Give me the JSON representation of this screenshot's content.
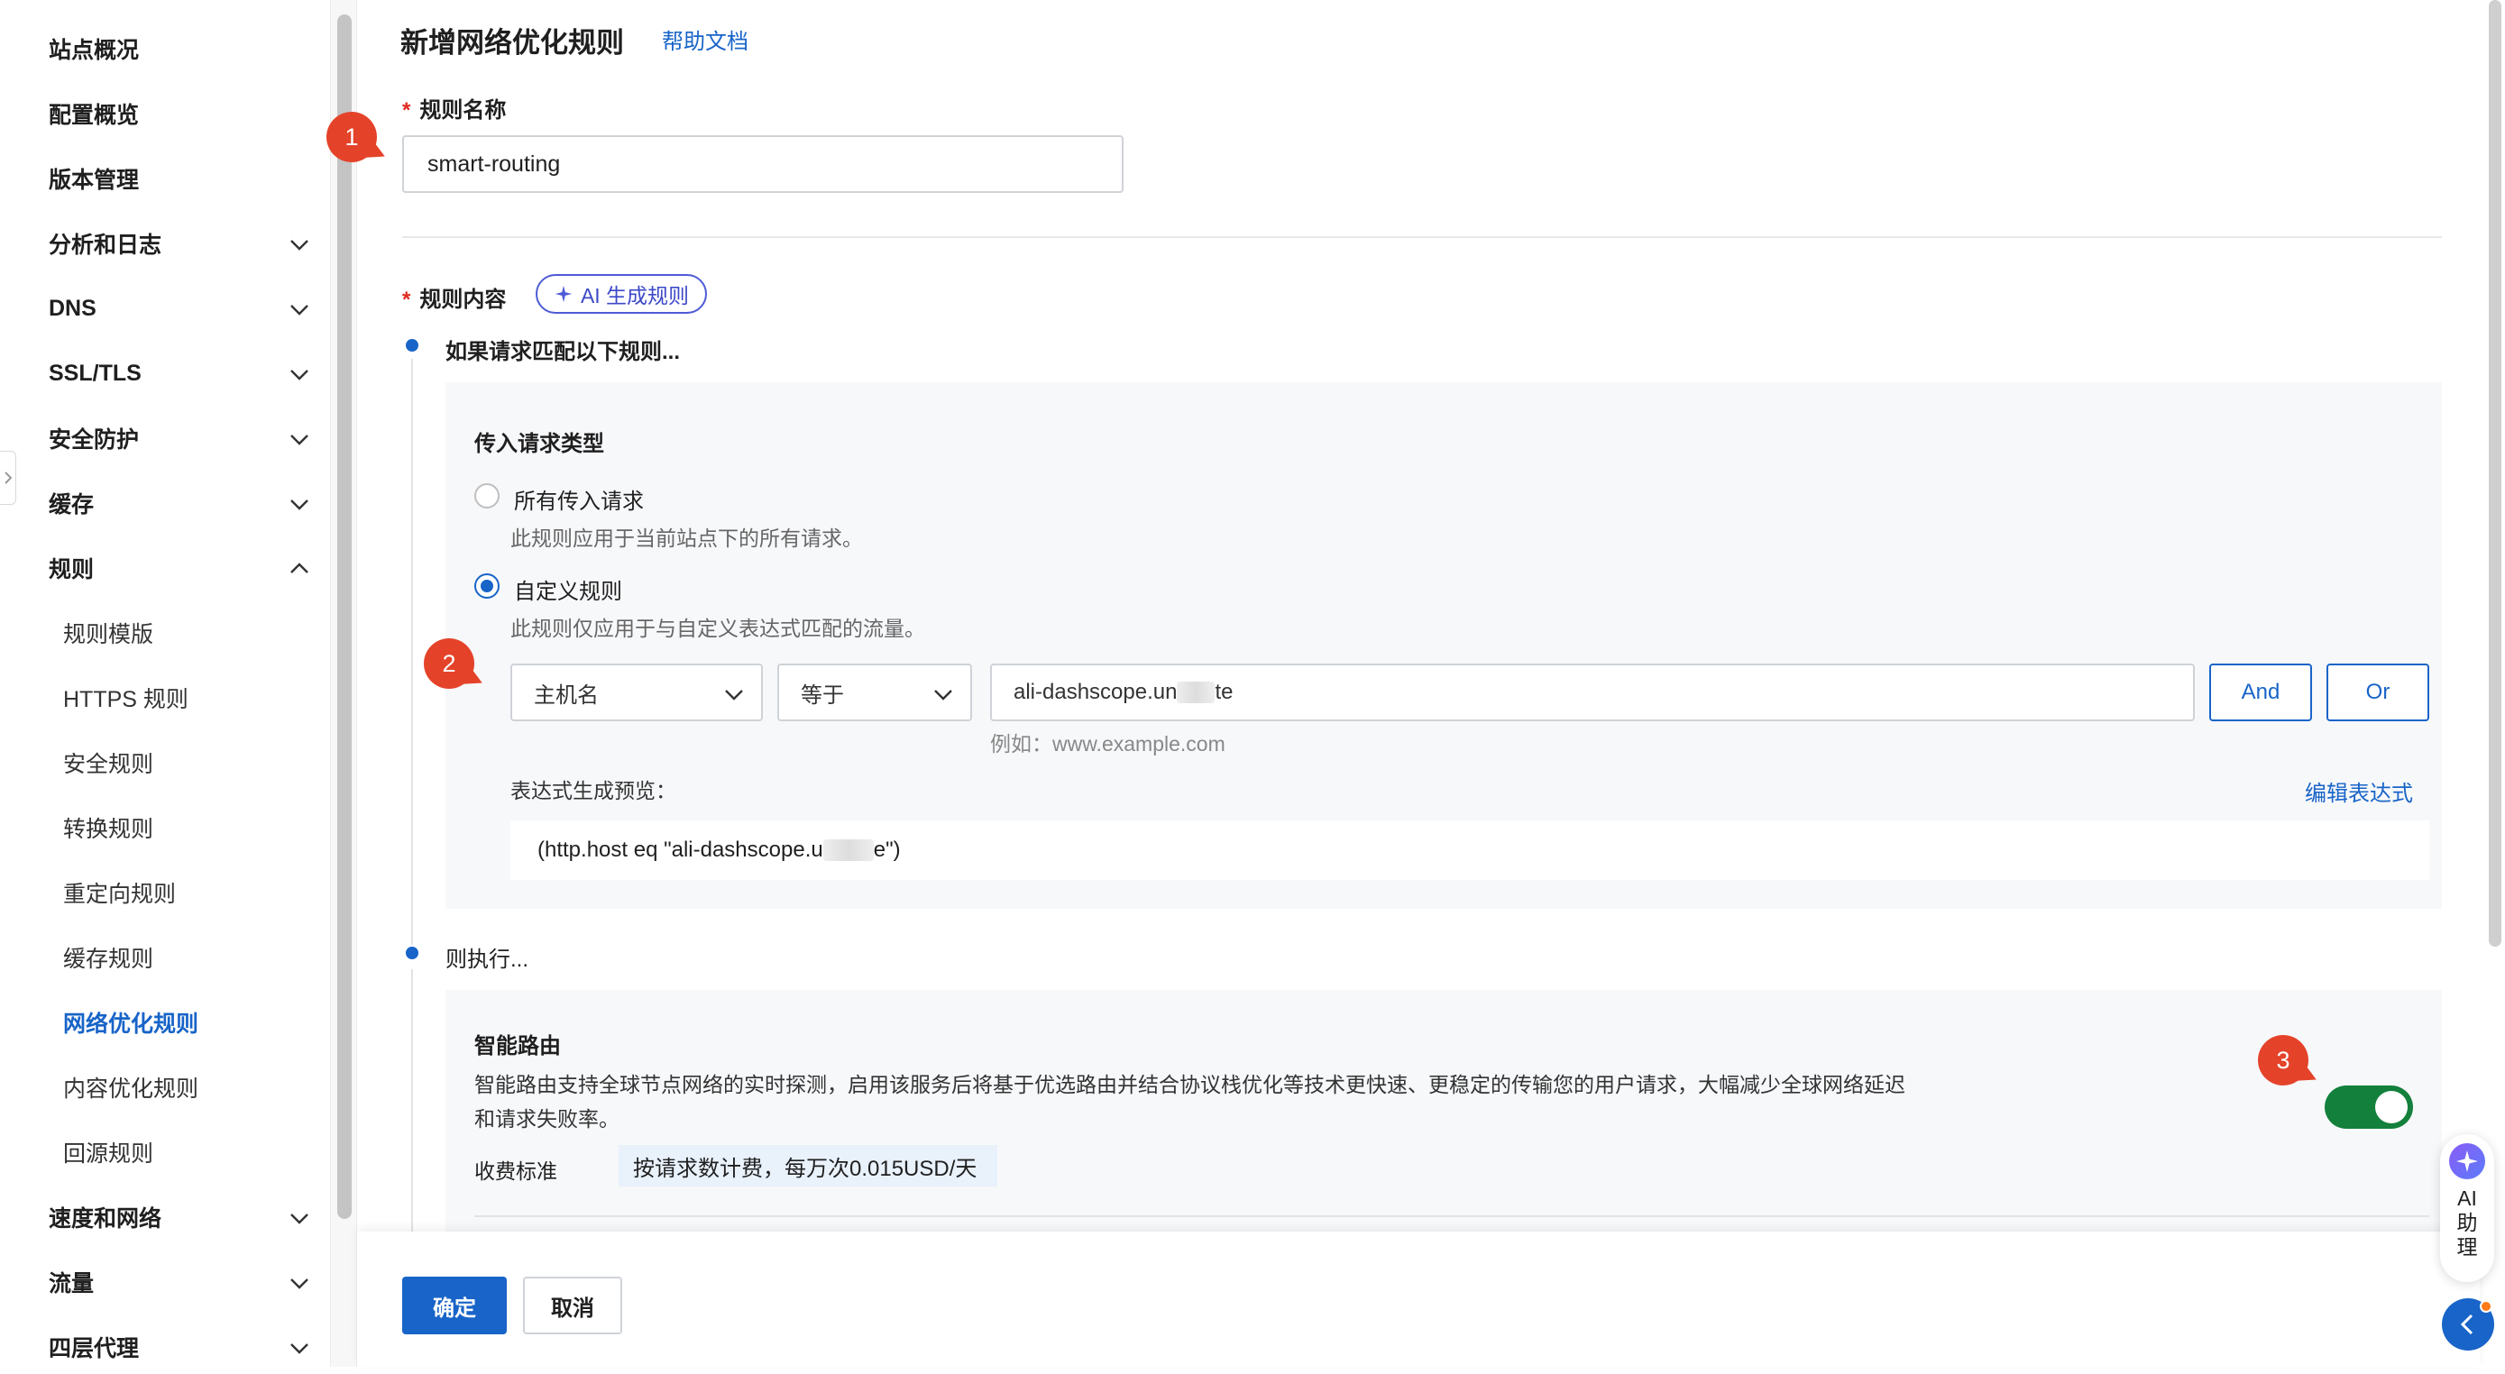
{
  "sidebar": {
    "items": [
      {
        "label": "站点概况"
      },
      {
        "label": "配置概览"
      },
      {
        "label": "版本管理"
      },
      {
        "label": "分析和日志"
      },
      {
        "label": "DNS"
      },
      {
        "label": "SSL/TLS"
      },
      {
        "label": "安全防护"
      },
      {
        "label": "缓存"
      },
      {
        "label": "规则"
      },
      {
        "label": "规则模版"
      },
      {
        "label": "HTTPS 规则"
      },
      {
        "label": "安全规则"
      },
      {
        "label": "转换规则"
      },
      {
        "label": "重定向规则"
      },
      {
        "label": "缓存规则"
      },
      {
        "label": "网络优化规则"
      },
      {
        "label": "内容优化规则"
      },
      {
        "label": "回源规则"
      },
      {
        "label": "速度和网络"
      },
      {
        "label": "流量"
      },
      {
        "label": "四层代理"
      }
    ]
  },
  "header": {
    "title": "新增网络优化规则",
    "help_link": "帮助文档"
  },
  "rule_name": {
    "required_mark": "*",
    "label": "规则名称",
    "value": "smart-routing"
  },
  "rule_content": {
    "required_mark": "*",
    "label": "规则内容",
    "ai_button": "AI 生成规则",
    "step1_title": "如果请求匹配以下规则...",
    "incoming_type_label": "传入请求类型",
    "options": [
      {
        "label": "所有传入请求",
        "desc": "此规则应用于当前站点下的所有请求。",
        "checked": false
      },
      {
        "label": "自定义规则",
        "desc": "此规则仅应用于与自定义表达式匹配的流量。",
        "checked": true
      }
    ],
    "condition": {
      "field": "主机名",
      "operator": "等于",
      "value_prefix": "ali-dashscope.un",
      "value_suffix": "te",
      "and_label": "And",
      "or_label": "Or",
      "hint": "例如：www.example.com"
    },
    "preview_label": "表达式生成预览：",
    "edit_expr_link": "编辑表达式",
    "preview_prefix": "(http.host eq \"ali-dashscope.u",
    "preview_suffix": "e\")",
    "step2_title": "则执行..."
  },
  "smart_routing": {
    "title": "智能路由",
    "desc_line1": "智能路由支持全球节点网络的实时探测，启用该服务后将基于优选路由并结合协议栈优化等技术更快速、更稳定的传输您的用户请求，大幅减少全球网络延迟",
    "desc_line2": "和请求失败率。",
    "fee_label": "收费标准",
    "fee_value": "按请求数计费，每万次0.015USD/天",
    "enabled": true
  },
  "annotations": [
    "1",
    "2",
    "3"
  ],
  "footer": {
    "confirm": "确定",
    "cancel": "取消"
  },
  "ai_assistant": {
    "label": "AI\n助\n理",
    "l1": "AI",
    "l2": "助",
    "l3": "理"
  },
  "colors": {
    "primary": "#1864c8",
    "toggle_on": "#13803c",
    "badge": "#e4432a",
    "ai_border": "#4e5bd6"
  },
  "icons": [
    "chevron-down-icon",
    "chevron-up-icon",
    "sparkle-icon",
    "caret-down-icon",
    "chevron-left-icon",
    "ai-star-icon"
  ]
}
